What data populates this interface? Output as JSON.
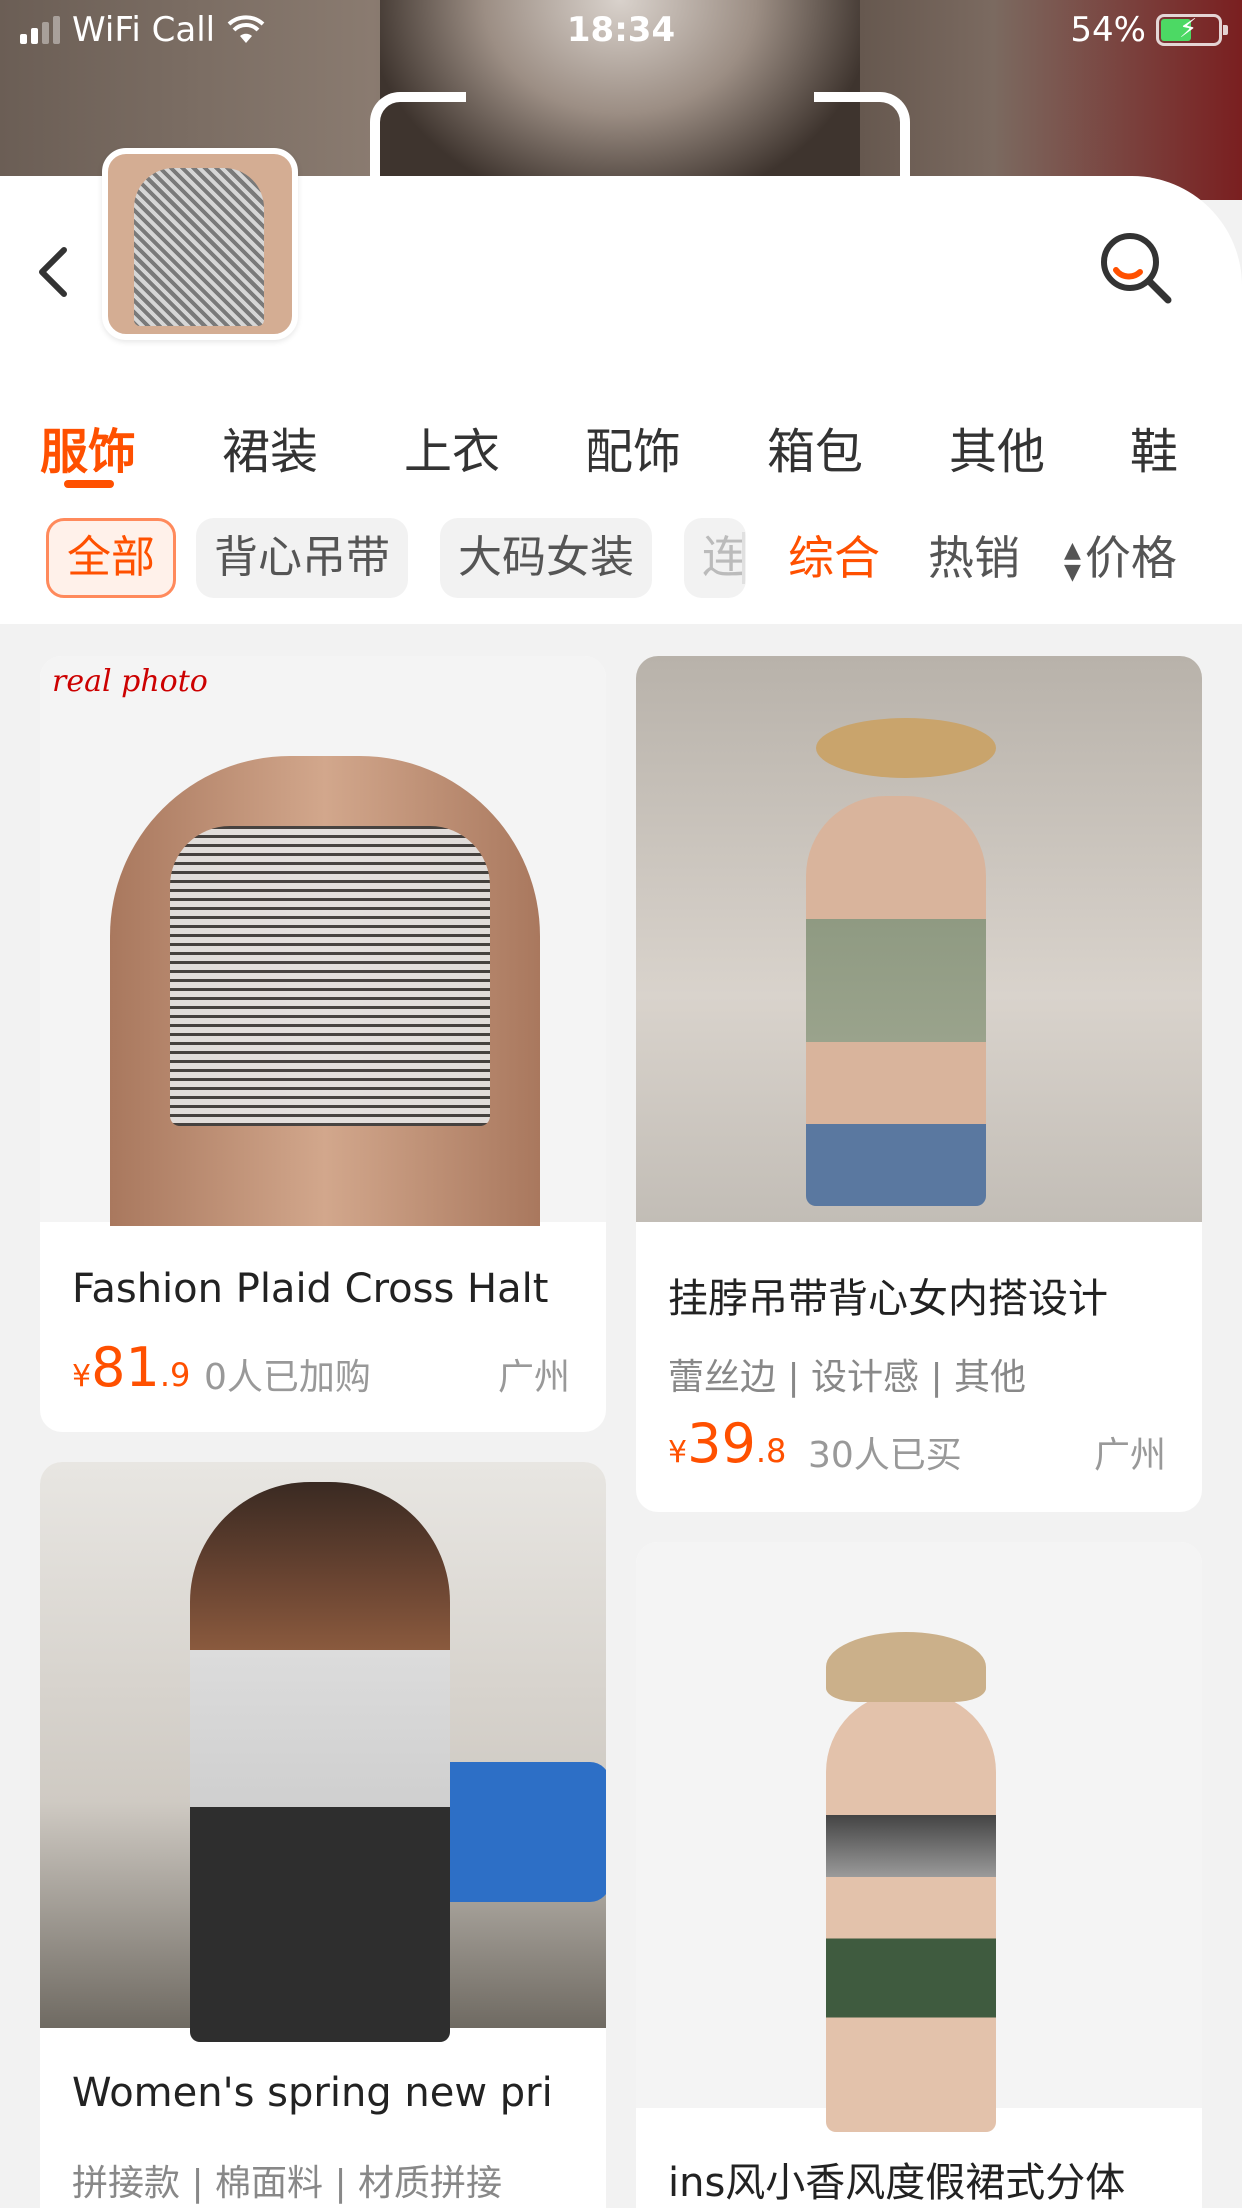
{
  "status_bar": {
    "carrier": "WiFi Call",
    "time": "18:34",
    "battery_pct": "54%",
    "battery_level": 0.54,
    "icons": [
      "signal-icon",
      "wifi-icon",
      "battery-charging-icon"
    ]
  },
  "search_header": {
    "back_icon": "chevron-left-icon",
    "search_icon": "search-lens-icon",
    "accent": "#ff5000"
  },
  "category_tabs": [
    {
      "label": "服饰",
      "active": true
    },
    {
      "label": "裙装",
      "active": false
    },
    {
      "label": "上衣",
      "active": false
    },
    {
      "label": "配饰",
      "active": false
    },
    {
      "label": "箱包",
      "active": false
    },
    {
      "label": "其他",
      "active": false
    },
    {
      "label": "鞋",
      "active": false
    }
  ],
  "filter_chips": [
    {
      "label": "全部",
      "active": true
    },
    {
      "label": "背心吊带",
      "active": false
    },
    {
      "label": "大码女装",
      "active": false
    },
    {
      "label": "连",
      "active": false
    }
  ],
  "sort_options": [
    {
      "label": "综合",
      "active": true
    },
    {
      "label": "热销",
      "active": false
    },
    {
      "label": "价格",
      "active": false
    }
  ],
  "products": [
    {
      "title": "Fashion Plaid Cross Halt",
      "image_caption": "real photo",
      "price_yen": "¥",
      "price_int": "81",
      "price_dec": ".9",
      "sold": "0人已加购",
      "city": "广州"
    },
    {
      "title": "挂脖吊带背心女内搭设计",
      "tags": "蕾丝边 | 设计感 | 其他",
      "price_yen": "¥",
      "price_int": "39",
      "price_dec": ".8",
      "sold": "30人已买",
      "city": "广州"
    },
    {
      "title": "Women's spring new pri",
      "tags": "拼接款 | 棉面料 | 材质拼接"
    },
    {
      "title": "ins风小香风度假裙式分体"
    }
  ]
}
